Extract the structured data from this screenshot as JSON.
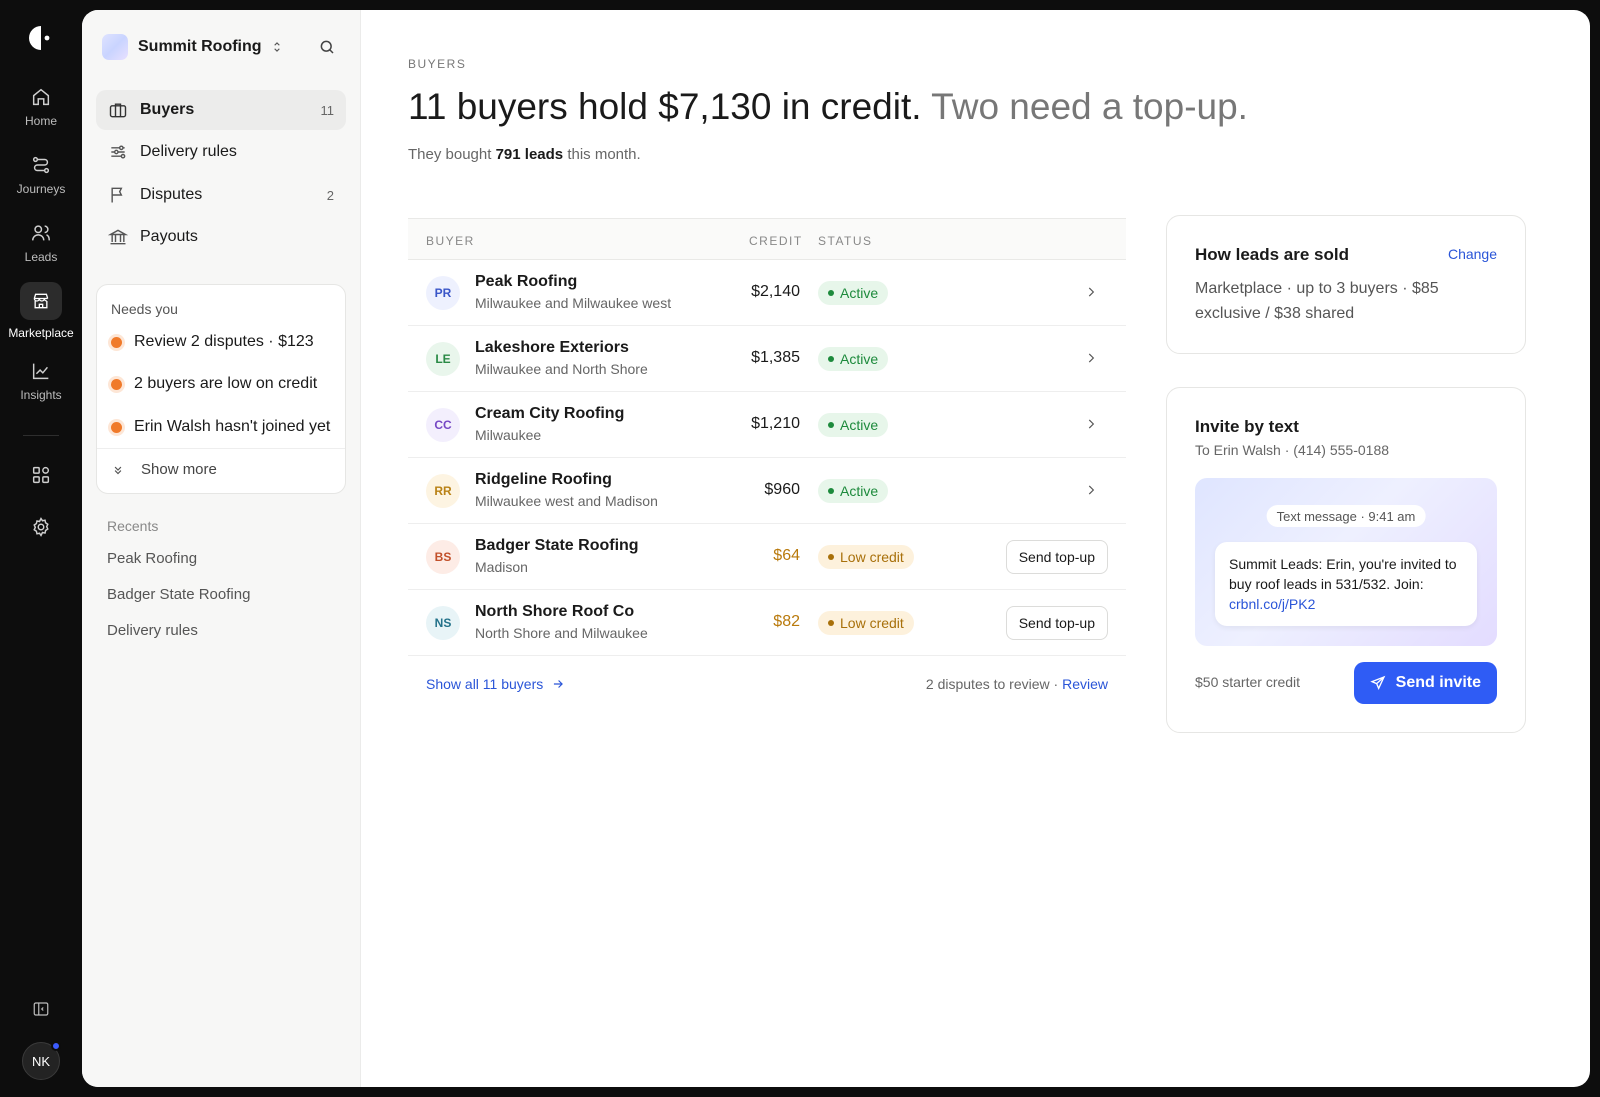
{
  "rail": {
    "items": [
      {
        "label": "Home",
        "icon": "home-icon"
      },
      {
        "label": "Journeys",
        "icon": "journeys-icon"
      },
      {
        "label": "Leads",
        "icon": "users-icon"
      },
      {
        "label": "Marketplace",
        "icon": "store-icon"
      },
      {
        "label": "Insights",
        "icon": "chart-icon"
      }
    ],
    "avatar": "NK"
  },
  "sidebar": {
    "workspace": "Summit Roofing",
    "nav": [
      {
        "label": "Buyers",
        "count": "11"
      },
      {
        "label": "Delivery rules",
        "count": ""
      },
      {
        "label": "Disputes",
        "count": "2"
      },
      {
        "label": "Payouts",
        "count": ""
      }
    ],
    "needs_you": {
      "title": "Needs you",
      "items": [
        "Review 2 disputes · $123",
        "2 buyers are low on credit",
        "Erin Walsh hasn't joined yet"
      ],
      "show_more": "Show more"
    },
    "recents": {
      "title": "Recents",
      "items": [
        "Peak Roofing",
        "Badger State Roofing",
        "Delivery rules"
      ]
    }
  },
  "main": {
    "eyebrow": "BUYERS",
    "headline_main": "11 buyers hold $7,130 in credit.",
    "headline_dim": "Two need a top-up.",
    "sub_prefix": "They bought",
    "sub_bold": "791 leads",
    "sub_suffix": "this month.",
    "table": {
      "headers": {
        "buyer": "BUYER",
        "credit": "CREDIT",
        "status": "STATUS"
      },
      "rows": [
        {
          "initials": "PR",
          "name": "Peak Roofing",
          "area": "Milwaukee and Milwaukee west",
          "credit": "$2,140",
          "status": "Active"
        },
        {
          "initials": "LE",
          "name": "Lakeshore Exteriors",
          "area": "Milwaukee and North Shore",
          "credit": "$1,385",
          "status": "Active"
        },
        {
          "initials": "CC",
          "name": "Cream City Roofing",
          "area": "Milwaukee",
          "credit": "$1,210",
          "status": "Active"
        },
        {
          "initials": "RR",
          "name": "Ridgeline Roofing",
          "area": "Milwaukee west and Madison",
          "credit": "$960",
          "status": "Active"
        },
        {
          "initials": "BS",
          "name": "Badger State Roofing",
          "area": "Madison",
          "credit": "$64",
          "status": "Low credit",
          "action": "Send top-up"
        },
        {
          "initials": "NS",
          "name": "North Shore Roof Co",
          "area": "North Shore and Milwaukee",
          "credit": "$82",
          "status": "Low credit",
          "action": "Send top-up"
        }
      ],
      "show_all": "Show all 11 buyers",
      "disputes_text": "2 disputes to review ·",
      "disputes_link": "Review"
    }
  },
  "how_sold": {
    "title": "How leads are sold",
    "change": "Change",
    "body": "Marketplace · up to 3 buyers · $85 exclusive / $38 shared"
  },
  "invite": {
    "title": "Invite by text",
    "to": "To Erin Walsh · (414) 555-0188",
    "sms_time": "Text message · 9:41 am",
    "sms_body": "Summit Leads: Erin, you're invited to buy roof leads in 531/532. Join:",
    "sms_link": "crbnl.co/j/PK2",
    "starter": "$50 starter credit",
    "button": "Send invite"
  },
  "colors": {
    "accent": "#2f5cf5",
    "active_green": "#1d8a3c",
    "low_amber": "#a8700a",
    "needs_dot": "#f07a2a"
  }
}
